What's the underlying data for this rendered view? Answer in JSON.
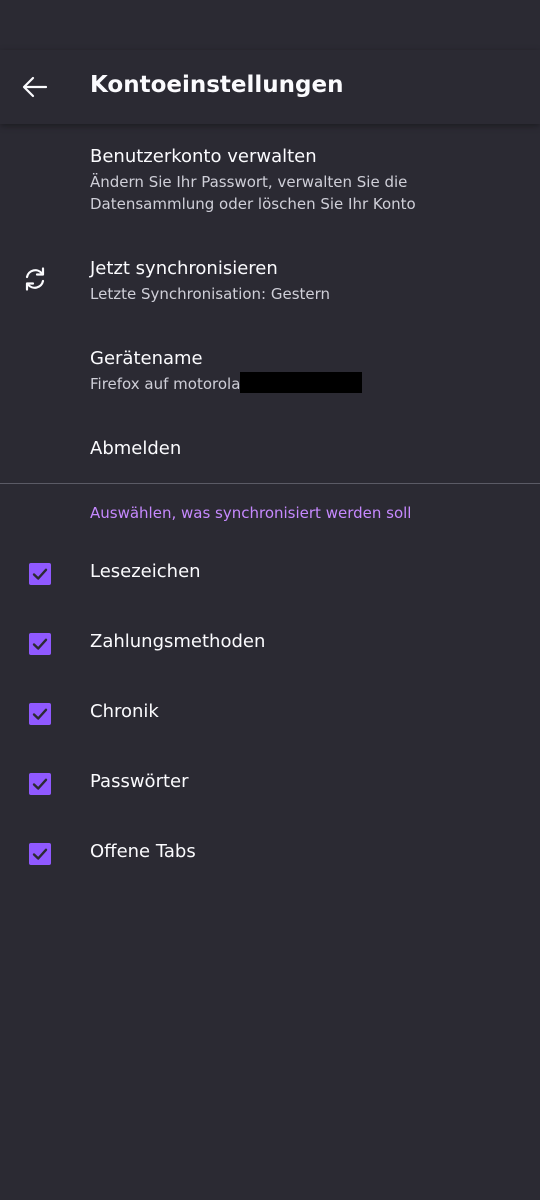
{
  "toolbar": {
    "title": "Kontoeinstellungen",
    "back_icon": "arrow-left-icon"
  },
  "account": {
    "manage": {
      "title": "Benutzerkonto verwalten",
      "summary": "Ändern Sie Ihr Passwort, verwalten Sie die Datensammlung oder löschen Sie Ihr Konto"
    },
    "sync_now": {
      "icon": "sync-icon",
      "title": "Jetzt synchronisieren",
      "summary": "Letzte Synchronisation: Gestern"
    },
    "device_name": {
      "title": "Gerätename",
      "value": "Firefox auf motorola"
    },
    "sign_out": {
      "title": "Abmelden"
    }
  },
  "sync_section": {
    "header": "Auswählen, was synchronisiert werden soll",
    "items": [
      {
        "label": "Lesezeichen",
        "checked": true
      },
      {
        "label": "Zahlungsmethoden",
        "checked": true
      },
      {
        "label": "Chronik",
        "checked": true
      },
      {
        "label": "Passwörter",
        "checked": true
      },
      {
        "label": "Offene Tabs",
        "checked": true
      }
    ]
  },
  "colors": {
    "background": "#2b2a33",
    "accent": "#9059ff",
    "category_text": "#c689ff",
    "primary_text": "#fbfbfe",
    "secondary_text": "#cfcfd8"
  }
}
